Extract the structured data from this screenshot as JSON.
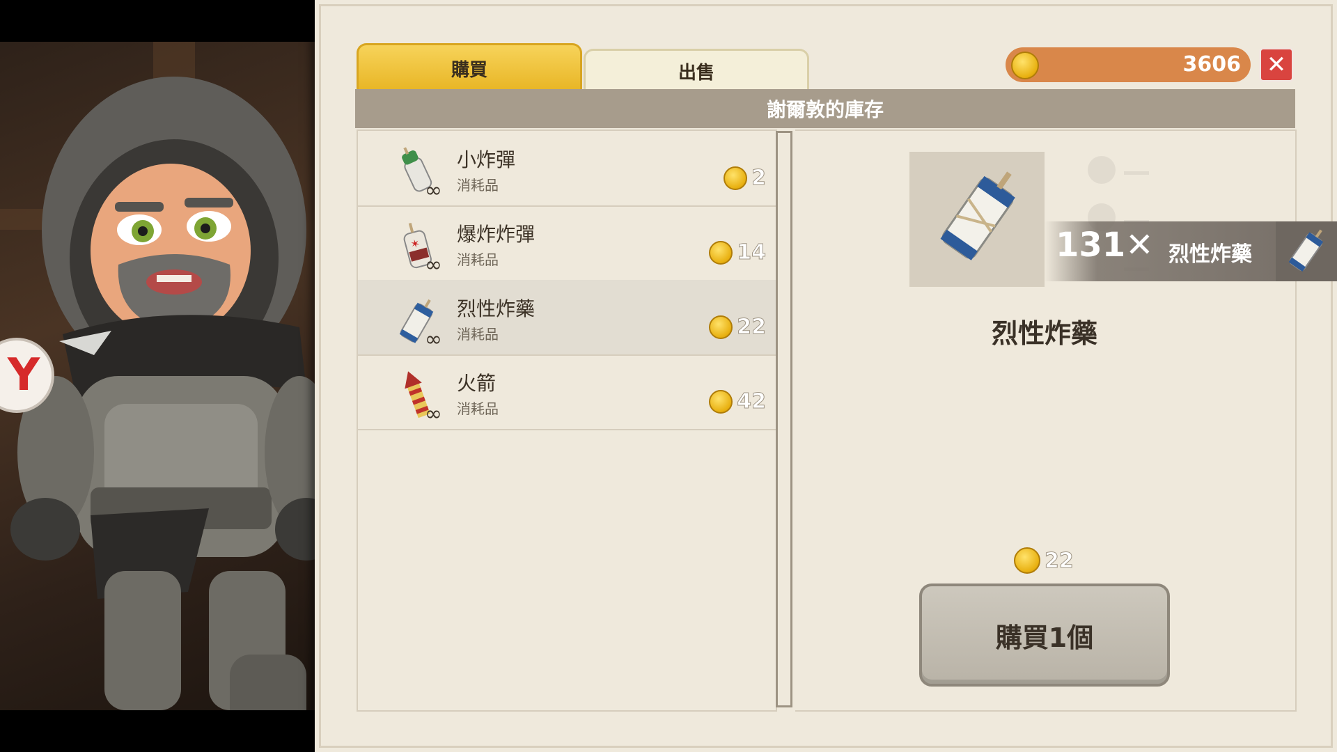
{
  "tabs": {
    "buy_label": "購買",
    "sell_label": "出售"
  },
  "currency": {
    "amount": "3606",
    "icon": "gold-coin-icon",
    "close_icon": "close-icon",
    "close_symbol": "✕"
  },
  "stock_title": "謝爾敦的庫存",
  "items": [
    {
      "name": "小炸彈",
      "type": "消耗品",
      "price": "2",
      "icon": "small-bomb-icon",
      "stock_symbol": "∞"
    },
    {
      "name": "爆炸炸彈",
      "type": "消耗品",
      "price": "14",
      "icon": "explosive-bomb-icon",
      "stock_symbol": "∞"
    },
    {
      "name": "烈性炸藥",
      "type": "消耗品",
      "price": "22",
      "icon": "strong-explosive-icon",
      "stock_symbol": "∞"
    },
    {
      "name": "火箭",
      "type": "消耗品",
      "price": "42",
      "icon": "rocket-icon",
      "stock_symbol": "∞"
    }
  ],
  "selected": {
    "name": "烈性炸藥",
    "price": "22",
    "buy_label": "購買1個"
  },
  "toast": {
    "quantity": "131✕",
    "name": "烈性炸藥"
  },
  "colors": {
    "tab_active": "#f0c43a",
    "coin_bar": "#d9874a",
    "close": "#d9443f",
    "header": "#a79c8c"
  },
  "character_badge": "Y"
}
